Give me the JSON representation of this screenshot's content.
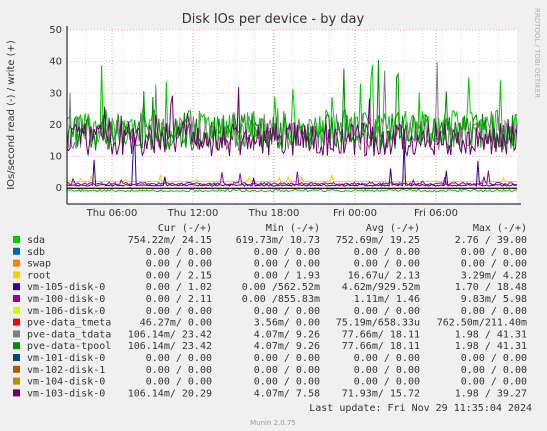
{
  "chart_data": {
    "type": "line",
    "title": "Disk IOs per device - by day",
    "ylabel": "IOs/second read (-) / write (+)",
    "watermark": "RRDTOOL / TOBI OETIKER",
    "ylim": [
      -5,
      50
    ],
    "y_ticks": [
      0,
      10,
      20,
      30,
      40,
      50
    ],
    "x_ticks": [
      "Thu 06:00",
      "Thu 12:00",
      "Thu 18:00",
      "Fri 00:00",
      "Fri 06:00"
    ],
    "x_tick_pos": [
      0.1,
      0.28,
      0.46,
      0.64,
      0.82
    ],
    "grid": true,
    "series": [
      {
        "name": "sda",
        "color": "#00cc00",
        "cur": "754.22m/ 24.15",
        "min": "619.73m/ 10.73",
        "avg": "752.69m/ 19.25",
        "max": "2.76 / 39.00"
      },
      {
        "name": "sdb",
        "color": "#0066b3",
        "cur": "0.00 / 0.00",
        "min": "0.00 / 0.00",
        "avg": "0.00 / 0.00",
        "max": "0.00 / 0.00"
      },
      {
        "name": "swap",
        "color": "#ff8000",
        "cur": "0.00 / 0.00",
        "min": "0.00 / 0.00",
        "avg": "0.00 / 0.00",
        "max": "0.00 / 0.00"
      },
      {
        "name": "root",
        "color": "#ffcc00",
        "cur": "0.00 / 2.15",
        "min": "0.00 / 1.93",
        "avg": "16.67u/ 2.13",
        "max": "3.29m/ 4.28"
      },
      {
        "name": "vm-105-disk-0",
        "color": "#330099",
        "cur": "0.00 / 1.02",
        "min": "0.00 /562.52m",
        "avg": "4.62m/929.52m",
        "max": "1.70 / 18.48"
      },
      {
        "name": "vm-100-disk-0",
        "color": "#990099",
        "cur": "0.00 / 2.11",
        "min": "0.00 /855.83m",
        "avg": "1.11m/ 1.46",
        "max": "9.83m/ 5.98"
      },
      {
        "name": "vm-106-disk-0",
        "color": "#ccff00",
        "cur": "0.00 / 0.00",
        "min": "0.00 / 0.00",
        "avg": "0.00 / 0.00",
        "max": "0.00 / 0.00"
      },
      {
        "name": "pve-data_tmeta",
        "color": "#ff0000",
        "cur": "46.27m/ 0.00",
        "min": "3.56m/ 0.00",
        "avg": "75.19m/658.33u",
        "max": "762.50m/211.40m"
      },
      {
        "name": "pve-data_tdata",
        "color": "#808080",
        "cur": "106.14m/ 23.42",
        "min": "4.07m/ 9.26",
        "avg": "77.66m/ 18.11",
        "max": "1.98 / 41.31"
      },
      {
        "name": "pve-data-tpool",
        "color": "#008f00",
        "cur": "106.14m/ 23.42",
        "min": "4.07m/ 9.26",
        "avg": "77.66m/ 18.11",
        "max": "1.98 / 41.31"
      },
      {
        "name": "vm-101-disk-0",
        "color": "#00487d",
        "cur": "0.00 / 0.00",
        "min": "0.00 / 0.00",
        "avg": "0.00 / 0.00",
        "max": "0.00 / 0.00"
      },
      {
        "name": "vm-102-disk-1",
        "color": "#b35a00",
        "cur": "0.00 / 0.00",
        "min": "0.00 / 0.00",
        "avg": "0.00 / 0.00",
        "max": "0.00 / 0.00"
      },
      {
        "name": "vm-104-disk-0",
        "color": "#b38f00",
        "cur": "0.00 / 0.00",
        "min": "0.00 / 0.00",
        "avg": "0.00 / 0.00",
        "max": "0.00 / 0.00"
      },
      {
        "name": "vm-103-disk-0",
        "color": "#6b006b",
        "cur": "106.14m/ 20.29",
        "min": "4.07m/ 7.58",
        "avg": "71.93m/ 15.72",
        "max": "1.98 / 39.27"
      }
    ],
    "legend_headers": {
      "cur": "Cur (-/+)",
      "min": "Min (-/+)",
      "avg": "Avg (-/+)",
      "max": "Max (-/+)"
    },
    "last_update": "Last update: Fri Nov 29 11:35:04 2024",
    "footer": "Munin 2.0.75"
  }
}
